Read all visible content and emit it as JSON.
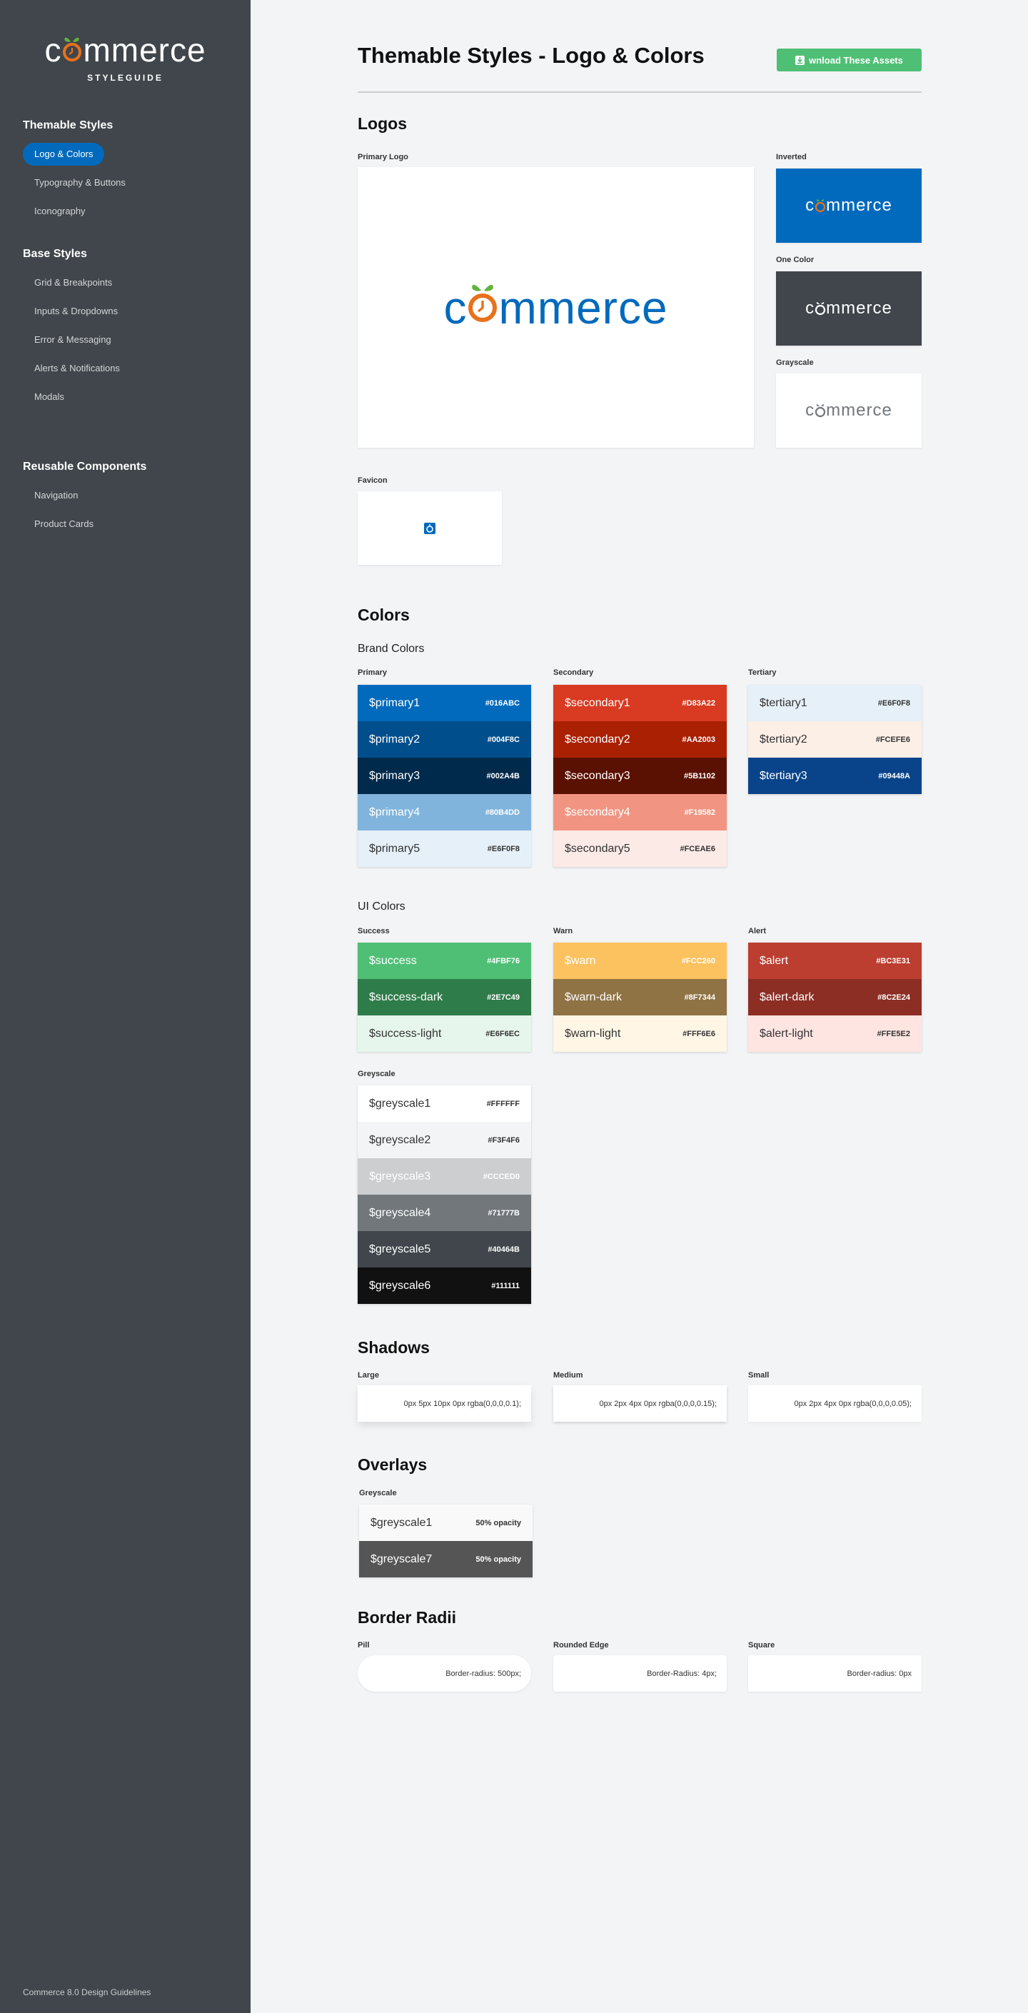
{
  "sidebar": {
    "brand": {
      "word_pre": "c",
      "word_post": "mmerce",
      "sub": "STYLEGUIDE"
    },
    "groups": [
      {
        "title": "Themable Styles",
        "items": [
          "Logo & Colors",
          "Typography & Buttons",
          "Iconography"
        ]
      },
      {
        "title": "Base Styles",
        "items": [
          "Grid & Breakpoints",
          "Inputs & Dropdowns",
          "Error & Messaging",
          "Alerts & Notifications",
          "Modals"
        ]
      },
      {
        "title": "Reusable Components",
        "items": [
          "Navigation",
          "Product Cards"
        ]
      }
    ],
    "footer": "Commerce 8.0 Design Guidelines"
  },
  "header": {
    "title": "Themable Styles - Logo & Colors",
    "download_label": "wnload These Assets"
  },
  "logos": {
    "heading": "Logos",
    "primary_label": "Primary Logo",
    "inverted_label": "Inverted",
    "one_color_label": "One Color",
    "grayscale_label": "Grayscale",
    "favicon_label": "Favicon",
    "logo_pre": "c",
    "logo_post": "mmerce"
  },
  "colors": {
    "heading": "Colors",
    "brand_heading": "Brand Colors",
    "primary": {
      "label": "Primary",
      "swatches": [
        {
          "name": "$primary1",
          "hex": "#016ABC",
          "bg": "#016abc",
          "fg": "#ffffff"
        },
        {
          "name": "$primary2",
          "hex": "#004F8C",
          "bg": "#004f8c",
          "fg": "#ffffff"
        },
        {
          "name": "$primary3",
          "hex": "#002A4B",
          "bg": "#002a4b",
          "fg": "#ffffff"
        },
        {
          "name": "$primary4",
          "hex": "#80B4DD",
          "bg": "#80b4dd",
          "fg": "#ffffff"
        },
        {
          "name": "$primary5",
          "hex": "#E6F0F8",
          "bg": "#e6f0f8",
          "fg": "#333333"
        }
      ]
    },
    "secondary": {
      "label": "Secondary",
      "swatches": [
        {
          "name": "$secondary1",
          "hex": "#D83A22",
          "bg": "#d83a22",
          "fg": "#ffffff"
        },
        {
          "name": "$secondary2",
          "hex": "#AA2003",
          "bg": "#aa2003",
          "fg": "#ffffff"
        },
        {
          "name": "$secondary3",
          "hex": "#5B1102",
          "bg": "#5b1102",
          "fg": "#ffffff"
        },
        {
          "name": "$secondary4",
          "hex": "#F19582",
          "bg": "#f19582",
          "fg": "#ffffff"
        },
        {
          "name": "$secondary5",
          "hex": "#FCEAE6",
          "bg": "#fceae6",
          "fg": "#333333"
        }
      ]
    },
    "tertiary": {
      "label": "Tertiary",
      "swatches": [
        {
          "name": "$tertiary1",
          "hex": "#E6F0F8",
          "bg": "#e6f0f8",
          "fg": "#333333"
        },
        {
          "name": "$tertiary2",
          "hex": "#FCEFE6",
          "bg": "#fcefe6",
          "fg": "#333333"
        },
        {
          "name": "$tertiary3",
          "hex": "#09448A",
          "bg": "#09448a",
          "fg": "#ffffff"
        }
      ]
    },
    "ui_heading": "UI Colors",
    "success": {
      "label": "Success",
      "swatches": [
        {
          "name": "$success",
          "hex": "#4FBF76",
          "bg": "#4fbf76",
          "fg": "#ffffff"
        },
        {
          "name": "$success-dark",
          "hex": "#2E7C49",
          "bg": "#2e7c49",
          "fg": "#ffffff"
        },
        {
          "name": "$success-light",
          "hex": "#E6F6EC",
          "bg": "#e6f6ec",
          "fg": "#333333"
        }
      ]
    },
    "warn": {
      "label": "Warn",
      "swatches": [
        {
          "name": "$warn",
          "hex": "#FCC260",
          "bg": "#fcc260",
          "fg": "#ffffff"
        },
        {
          "name": "$warn-dark",
          "hex": "#8F7344",
          "bg": "#8f7344",
          "fg": "#ffffff"
        },
        {
          "name": "$warn-light",
          "hex": "#FFF6E6",
          "bg": "#fff6e6",
          "fg": "#333333"
        }
      ]
    },
    "alert": {
      "label": "Alert",
      "swatches": [
        {
          "name": "$alert",
          "hex": "#BC3E31",
          "bg": "#bc3e31",
          "fg": "#ffffff"
        },
        {
          "name": "$alert-dark",
          "hex": "#8C2E24",
          "bg": "#8c2e24",
          "fg": "#ffffff"
        },
        {
          "name": "$alert-light",
          "hex": "#FFE5E2",
          "bg": "#ffe5e2",
          "fg": "#333333"
        }
      ]
    },
    "greyscale": {
      "label": "Greyscale",
      "swatches": [
        {
          "name": "$greyscale1",
          "hex": "#FFFFFF",
          "bg": "#ffffff",
          "fg": "#333333"
        },
        {
          "name": "$greyscale2",
          "hex": "#F3F4F6",
          "bg": "#f3f4f6",
          "fg": "#333333"
        },
        {
          "name": "$greyscale3",
          "hex": "#CCCED0",
          "bg": "#ccced0",
          "fg": "#ffffff"
        },
        {
          "name": "$greyscale4",
          "hex": "#71777B",
          "bg": "#71777b",
          "fg": "#ffffff"
        },
        {
          "name": "$greyscale5",
          "hex": "#40464B",
          "bg": "#40464b",
          "fg": "#ffffff"
        },
        {
          "name": "$greyscale6",
          "hex": "#111111",
          "bg": "#111111",
          "fg": "#ffffff"
        }
      ]
    }
  },
  "shadows": {
    "heading": "Shadows",
    "items": [
      {
        "label": "Large",
        "value": "0px 5px 10px 0px rgba(0,0,0,0.1);"
      },
      {
        "label": "Medium",
        "value": "0px 2px 4px 0px rgba(0,0,0,0.15);"
      },
      {
        "label": "Small",
        "value": "0px 2px 4px 0px rgba(0,0,0,0.05);"
      }
    ]
  },
  "overlays": {
    "heading": "Overlays",
    "label": "Greyscale",
    "items": [
      {
        "name": "$greyscale1",
        "value": "50% opacity",
        "bg": "#f9f9fa",
        "fg": "#333333"
      },
      {
        "name": "$greyscale7",
        "value": "50% opacity",
        "bg": "#555555",
        "fg": "#ffffff"
      }
    ]
  },
  "radii": {
    "heading": "Border Radii",
    "items": [
      {
        "label": "Pill",
        "value": "Border-radius: 500px;"
      },
      {
        "label": "Rounded Edge",
        "value": "Border-Radius: 4px;"
      },
      {
        "label": "Square",
        "value": "Border-radius: 0px"
      }
    ]
  },
  "accent_colors": {
    "blue": "#016abc",
    "orange": "#e8711c",
    "green": "#4fbf76",
    "leaf": "#63b33c"
  }
}
